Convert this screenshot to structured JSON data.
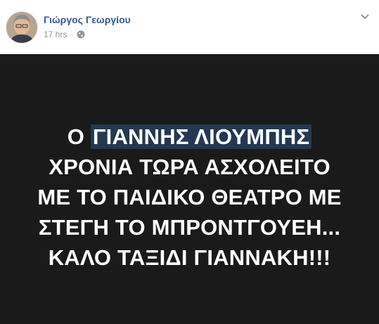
{
  "post": {
    "author_name": "Γιώργος Γεωργίου",
    "timestamp": "17 hrs",
    "separator": "·",
    "privacy_icon": "globe-icon",
    "more_icon": "chevron-down-icon",
    "text_lines": {
      "line1_prefix": "Ο ",
      "line1_highlight": "ΓΙΑΝΝΗΣ ΛΙΟΥΜΠΗΣ",
      "line2": "ΧΡΟΝΙΑ ΤΩΡΑ ΑΣΧΟΛΕΙΤΟ",
      "line3": "ΜΕ ΤΟ ΠΑΙΔΙΚΟ ΘΕΑΤΡΟ ΜΕ",
      "line4": "ΣΤΕΓΗ ΤΟ ΜΠΡΟΝΤΓΟΥΕΗ...",
      "line5": "ΚΑΛΟ ΤΑΞΙΔΙ ΓΙΑΝΝΑΚΗ!!!"
    }
  },
  "colors": {
    "author_link": "#365899",
    "meta_text": "#90949c",
    "post_background": "#1a1a1a",
    "post_text": "#ffffff",
    "highlight": "#243851"
  }
}
